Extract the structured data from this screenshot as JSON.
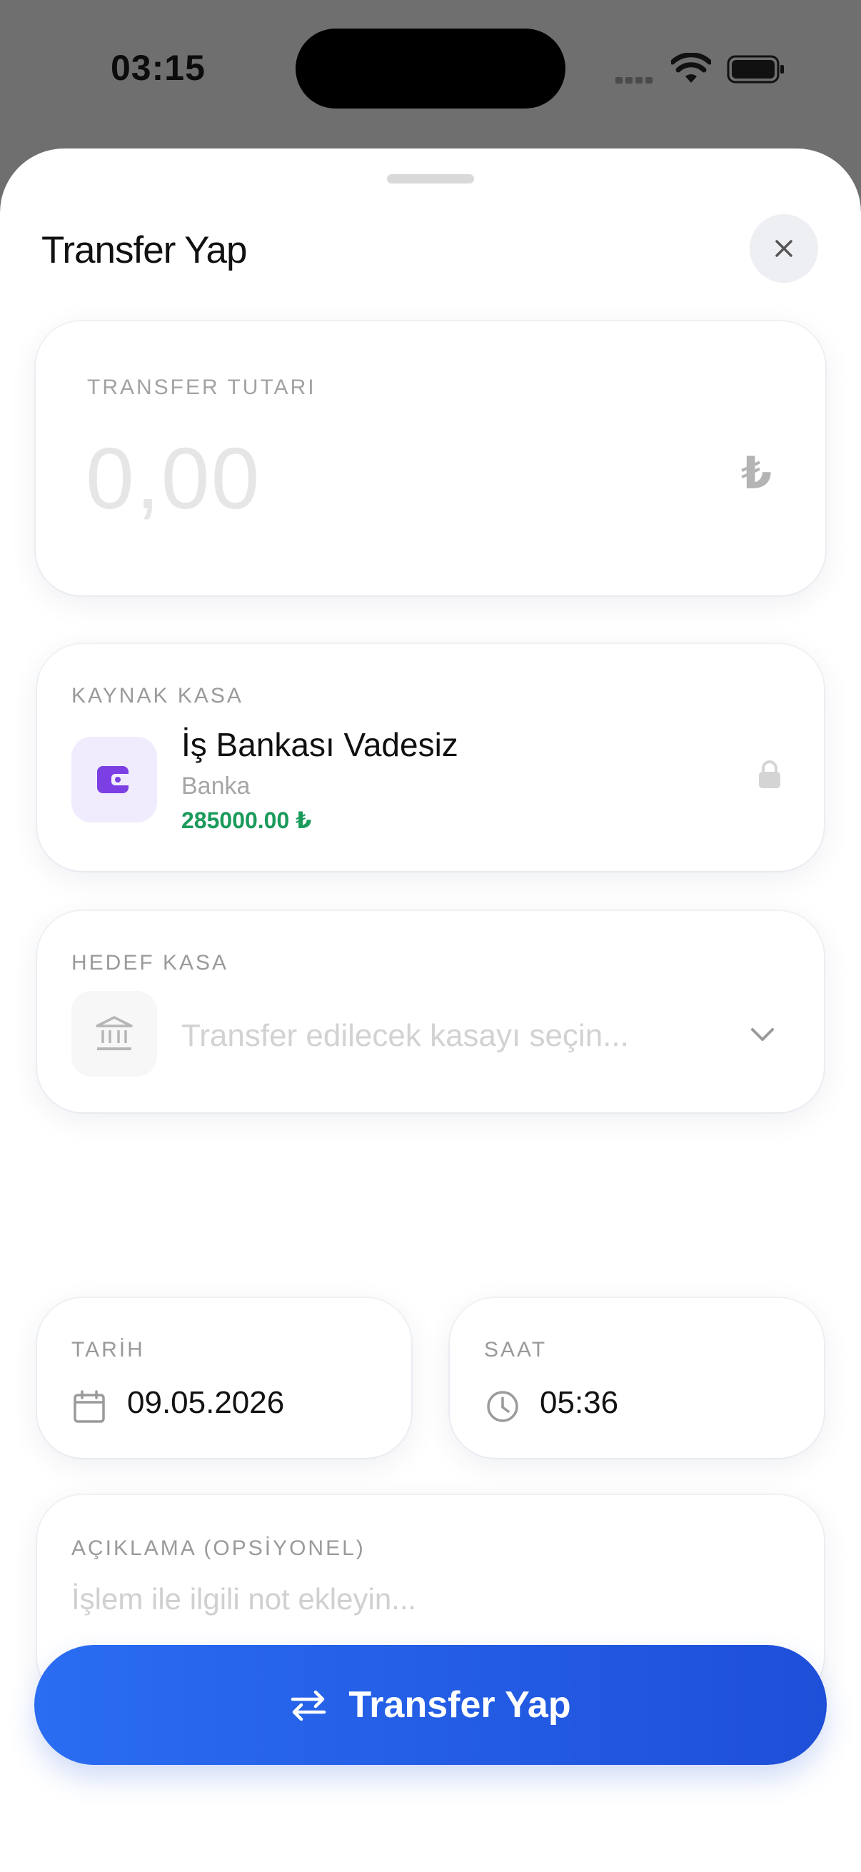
{
  "status_bar": {
    "time": "03:15"
  },
  "sheet": {
    "title": "Transfer Yap"
  },
  "amount": {
    "label": "TRANSFER TUTARI",
    "value": "0,00",
    "currency_symbol": "₺"
  },
  "source": {
    "label": "KAYNAK KASA",
    "account_name": "İş Bankası Vadesiz",
    "account_type": "Banka",
    "balance": "285000.00 ₺"
  },
  "target": {
    "label": "HEDEF KASA",
    "placeholder": "Transfer edilecek kasayı seçin..."
  },
  "date": {
    "label": "TARİH",
    "value": "09.05.2026"
  },
  "time": {
    "label": "SAAT",
    "value": "05:36"
  },
  "description": {
    "label": "AÇIKLAMA (OPSİYONEL)",
    "placeholder": "İşlem ile ilgili not ekleyin..."
  },
  "submit": {
    "label": "Transfer Yap"
  },
  "colors": {
    "accent": "#2563eb",
    "balance_green": "#1a9a5b",
    "wallet_purple": "#7b3fe4"
  }
}
